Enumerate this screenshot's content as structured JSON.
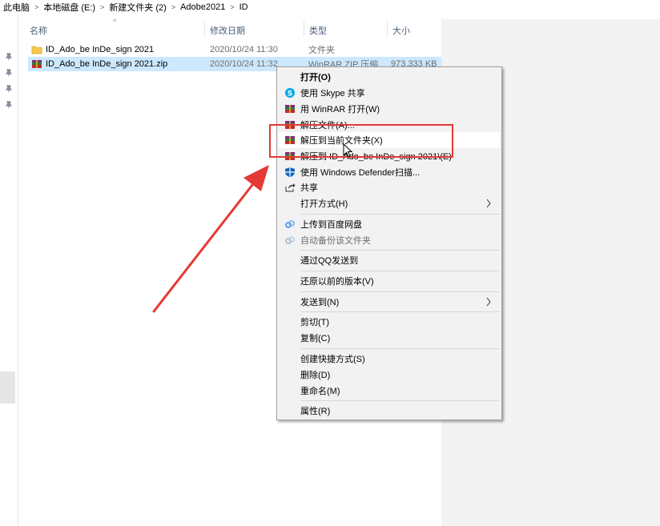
{
  "breadcrumb": {
    "items": [
      "此电脑",
      "本地磁盘 (E:)",
      "新建文件夹 (2)",
      "Adobe2021",
      "ID"
    ]
  },
  "columns": {
    "name": "名称",
    "date": "修改日期",
    "type": "类型",
    "size": "大小"
  },
  "files": [
    {
      "name": "ID_Ado_be InDe_sign 2021",
      "date": "2020/10/24 11:30",
      "type": "文件夹",
      "size": "",
      "icon": "folder-icon"
    },
    {
      "name": "ID_Ado_be InDe_sign 2021.zip",
      "date": "2020/10/24 11:32",
      "type": "WinRAR ZIP 压缩...",
      "size": "973,333 KB",
      "icon": "winrar-icon"
    }
  ],
  "context_menu": {
    "items": [
      {
        "label": "打开(O)",
        "icon": "",
        "bold": true
      },
      {
        "label": "使用 Skype 共享",
        "icon": "skype-icon"
      },
      {
        "label": "用 WinRAR 打开(W)",
        "icon": "winrar-icon"
      },
      {
        "label": "解压文件(A)...",
        "icon": "winrar-icon"
      },
      {
        "label": "解压到当前文件夹(X)",
        "icon": "winrar-icon",
        "hover": true
      },
      {
        "label": "解压到 ID_Ado_be InDe_sign 2021\\(E)",
        "icon": "winrar-icon"
      },
      {
        "label": "使用 Windows Defender扫描...",
        "icon": "defender-shield-icon"
      },
      {
        "label": "共享",
        "icon": "share-icon"
      },
      {
        "label": "打开方式(H)",
        "icon": "",
        "submenu": true
      },
      {
        "label": "上传到百度网盘",
        "icon": "baidu-netdisk-icon"
      },
      {
        "label": "自动备份该文件夹",
        "icon": "baidu-netdisk-icon",
        "disabled": true
      },
      {
        "label": "通过QQ发送到",
        "icon": ""
      },
      {
        "label": "还原以前的版本(V)",
        "icon": ""
      },
      {
        "label": "发送到(N)",
        "icon": "",
        "submenu": true
      },
      {
        "label": "剪切(T)",
        "icon": ""
      },
      {
        "label": "复制(C)",
        "icon": ""
      },
      {
        "label": "创建快捷方式(S)",
        "icon": ""
      },
      {
        "label": "删除(D)",
        "icon": ""
      },
      {
        "label": "重命名(M)",
        "icon": ""
      },
      {
        "label": "属性(R)",
        "icon": ""
      }
    ]
  },
  "colors": {
    "selection": "#cce8ff",
    "annotation": "#e53935",
    "menu_bg": "#f2f2f2"
  }
}
